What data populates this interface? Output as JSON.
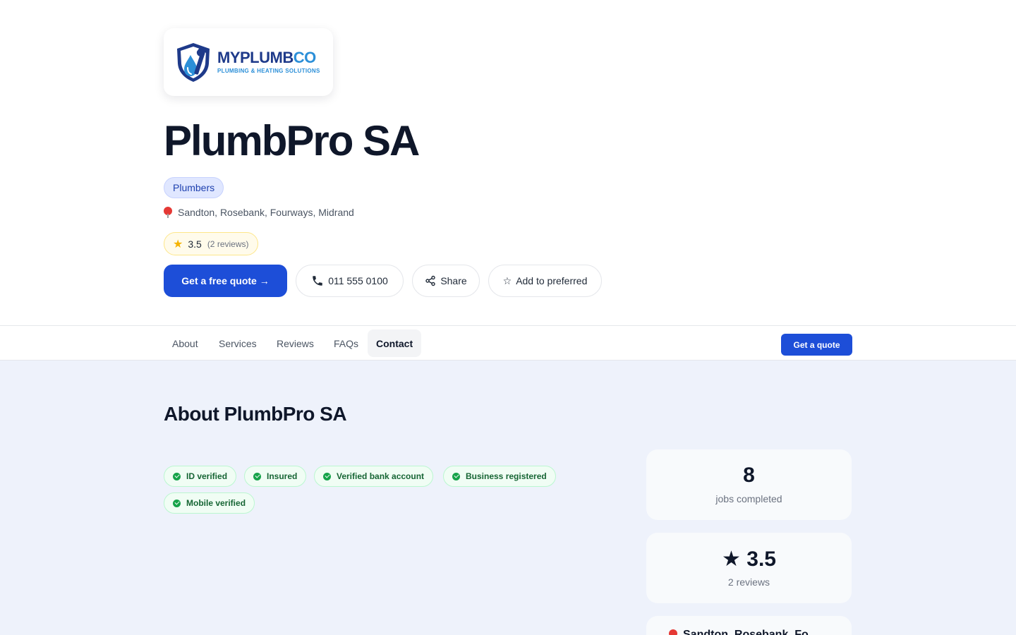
{
  "brand": {
    "logo_main_left": "MYPLUMB",
    "logo_main_right": "CO",
    "logo_tagline": "PLUMBING & HEATING SOLUTIONS",
    "colors": {
      "navy": "#1e3a8a",
      "light_blue": "#2b8fd8"
    }
  },
  "business": {
    "name": "PlumbPro SA",
    "category": "Plumbers",
    "areas": "Sandton, Rosebank, Fourways, Midrand",
    "rating": "3.5",
    "review_count": "(2 reviews)"
  },
  "actions": {
    "quote": "Get a free quote →",
    "phone": "011 555 0100",
    "share": "Share",
    "preferred": "Add to preferred"
  },
  "tabs": [
    {
      "label": "About",
      "active": false
    },
    {
      "label": "Services",
      "active": false
    },
    {
      "label": "Reviews",
      "active": false
    },
    {
      "label": "FAQs",
      "active": false
    },
    {
      "label": "Contact",
      "active": true
    }
  ],
  "tabbar_cta": "Get a quote",
  "about": {
    "title": "About PlumbPro SA",
    "badges": [
      "ID verified",
      "Insured",
      "Verified bank account",
      "Business registered",
      "Mobile verified"
    ]
  },
  "stats": {
    "jobs_value": "8",
    "jobs_label": "jobs completed",
    "rating_value": "3.5",
    "rating_label": "2 reviews",
    "location_text": "Sandton, Rosebank, Fo"
  },
  "colors": {
    "primary": "#1d4ed8",
    "star": "#f5b301",
    "verified_green": "#16a34a",
    "content_bg": "#eef2fb"
  },
  "icons": [
    "shield-wrench-logo-icon",
    "map-pin-icon",
    "star-icon",
    "phone-icon",
    "share-icon",
    "star-outline-icon",
    "check-circle-icon"
  ]
}
